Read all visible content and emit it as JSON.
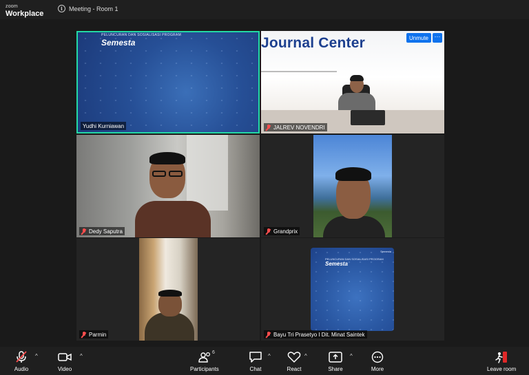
{
  "app": {
    "logo_line1": "zoom",
    "logo_line2": "Workplace"
  },
  "meeting": {
    "title": "Meeting - Room 1"
  },
  "tiles": [
    {
      "name": "Yudhi Kurniawan",
      "slide_title": "PELUNCURAN DAN SOSIALISASI PROGRAM",
      "slide_brand": "Semesta"
    },
    {
      "name": "JALREV NOVENDRI",
      "sign": "Journal Center",
      "unmute_label": "Unmute",
      "more_label": "···"
    },
    {
      "name": "Dedy Saputra"
    },
    {
      "name": "Grandprix"
    },
    {
      "name": "Parmin"
    },
    {
      "name": "Bayu Tri Prasetyo I Dit. Minat Saintek",
      "slide_title": "PELUNCURAN DAN SOSIALISASI PROGRAM",
      "slide_brand": "Semesta",
      "slide_header_right": "Semesta"
    }
  ],
  "toolbar": {
    "audio": "Audio",
    "video": "Video",
    "participants": "Participants",
    "participants_count": "6",
    "chat": "Chat",
    "react": "React",
    "share": "Share",
    "more": "More",
    "leave": "Leave room"
  },
  "colors": {
    "active_border": "#23d9a5",
    "unmute_bg": "#0e72ed",
    "muted_red": "#ff4d4d",
    "leave_red": "#e02828"
  }
}
